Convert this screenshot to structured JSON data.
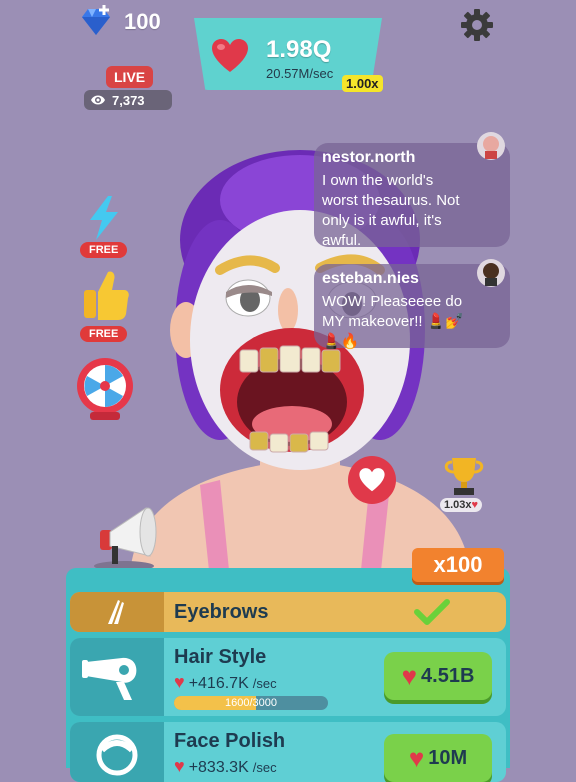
{
  "currency": {
    "gems": "100"
  },
  "hearts": {
    "amount": "1.98Q",
    "rate": "20.57M/sec",
    "multiplier": "1.00x"
  },
  "stream": {
    "live_label": "LIVE",
    "viewers": "7,373"
  },
  "boosters": {
    "lightning_label": "FREE",
    "thumbs_label": "FREE"
  },
  "chat": [
    {
      "user": "nestor.north",
      "message": "I own the world's worst thesaurus. Not only is it awful, it's awful."
    },
    {
      "user": "esteban.nies",
      "message": "WOW! Pleaseeee do MY makeover!! 💄💅💄🔥"
    }
  ],
  "trophy": {
    "multiplier": "1.03x"
  },
  "buy_multiplier": "x100",
  "upgrades": [
    {
      "title": "Eyebrows",
      "status": "complete"
    },
    {
      "title": "Hair Style",
      "rate": "+416.7K",
      "rate_unit": "/sec",
      "progress_text": "1600/3000",
      "progress": 0.533,
      "cost": "4.51B"
    },
    {
      "title": "Face Polish",
      "rate": "+833.3K",
      "rate_unit": "/sec",
      "cost": "10M"
    }
  ],
  "colors": {
    "background": "#9b8fb5",
    "panel": "#5fd2cf",
    "accent_red": "#e0394a",
    "buy_green": "#7ad14a",
    "eyebrows_row": "#e8b95a",
    "upgrade_row": "#5fcfd4"
  }
}
